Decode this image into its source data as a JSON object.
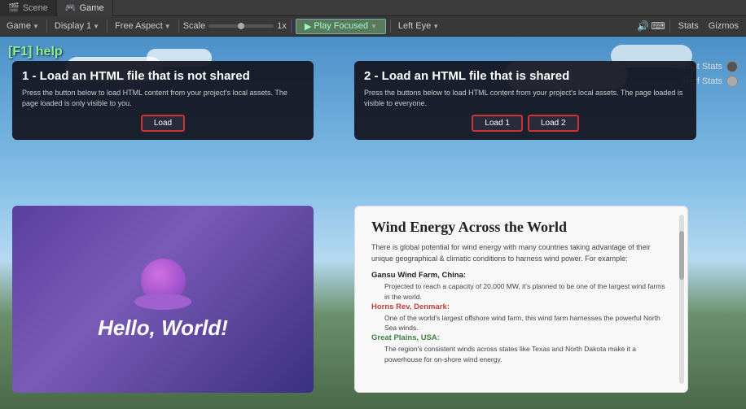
{
  "tabs": [
    {
      "label": "Scene",
      "icon": "🎬",
      "active": false
    },
    {
      "label": "Game",
      "icon": "🎮",
      "active": true
    }
  ],
  "toolbar": {
    "game_label": "Game",
    "display_label": "Display 1",
    "aspect_label": "Free Aspect",
    "scale_label": "Scale",
    "scale_value": "1x",
    "play_label": "Play Focused",
    "left_eye_label": "Left Eye",
    "stats_label": "Stats",
    "gizmos_label": "Gizmos"
  },
  "game_view": {
    "f1_help": "[F1] help",
    "script_stats_label": "Script Stats",
    "perf_stats_label": "Perf Stats"
  },
  "card_left_top": {
    "title": "1 - Load an HTML file that is not shared",
    "description": "Press the button below to load HTML content from your project's local assets. The page loaded is only visible to you.",
    "load_btn": "Load"
  },
  "card_right_top": {
    "title": "2 - Load an HTML file that is shared",
    "description": "Press the buttons below to load HTML content from your project's local assets. The page loaded is visible to everyone.",
    "load1_btn": "Load 1",
    "load2_btn": "Load 2"
  },
  "card_bottom_left": {
    "hello_text": "Hello, World!"
  },
  "card_bottom_right": {
    "article_title": "Wind Energy Across the World",
    "intro": "There is global potential for wind energy with many countries taking advantage of their unique geographical & climatic conditions to harness wind power. For example:",
    "section1_title": "Gansu Wind Farm, China:",
    "section1_sub1": "Projected to reach a capacity of 20,000 MW, it's planned to be one of the largest wind farms in the world.",
    "section2_title": "Horns Rev, Denmark:",
    "section2_sub1": "One of the world's largest offshore wind farm, this wind farm harnesses the powerful North Sea winds.",
    "section3_title": "Great Plains, USA:",
    "section3_sub1": "The region's consistent winds across states like Texas and North Dakota make it a powerhouse for on-shore wind energy."
  }
}
